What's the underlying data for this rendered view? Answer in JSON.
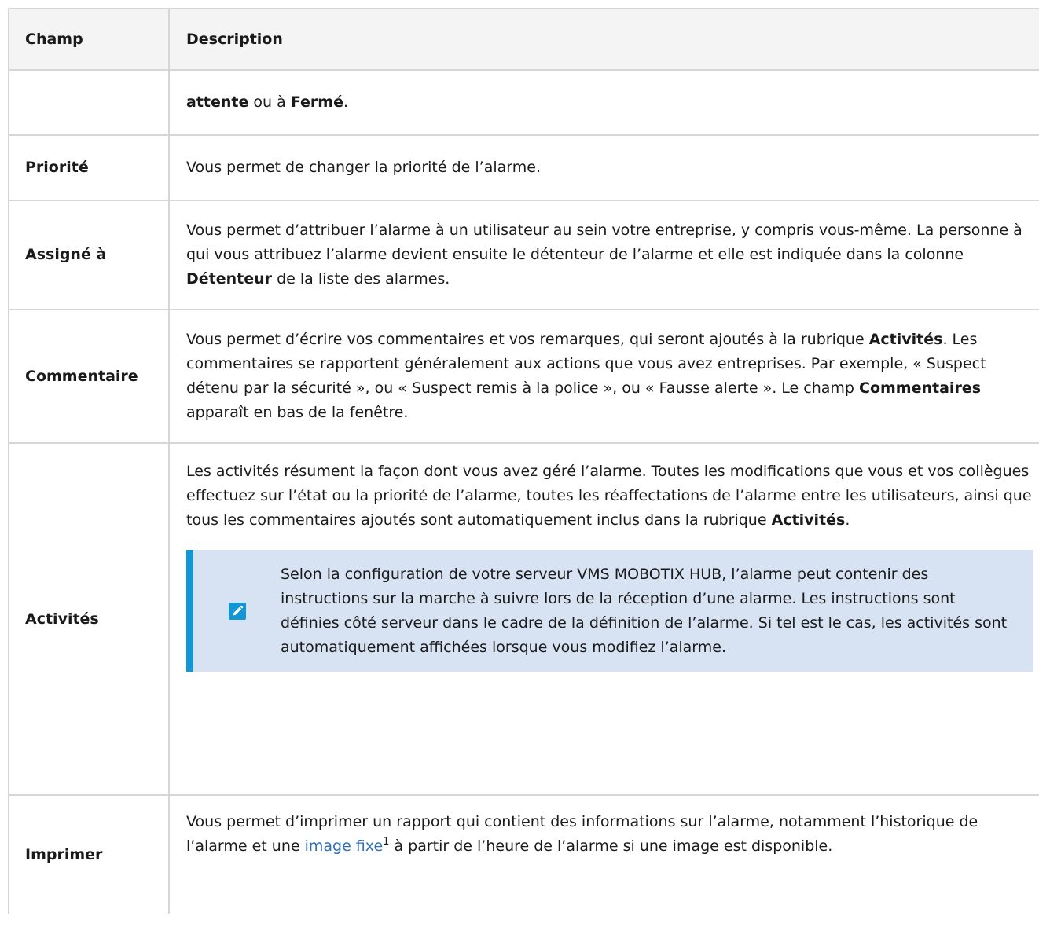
{
  "table": {
    "headers": {
      "field": "Champ",
      "description": "Description"
    },
    "rows": {
      "continuation": {
        "field": "",
        "desc_b1": "attente",
        "desc_t1": " ou à ",
        "desc_b2": "Fermé",
        "desc_t2": "."
      },
      "priorite": {
        "field": "Priorité",
        "desc": "Vous permet de changer la priorité de l’alarme."
      },
      "assigne": {
        "field": "Assigné à",
        "desc_t1": "Vous permet d’attribuer l’alarme à un utilisateur au sein votre entreprise, y compris vous-même. La personne à qui vous attribuez l’alarme devient ensuite le détenteur de l’alarme et elle est indiquée dans la colonne ",
        "desc_b1": "Détenteur",
        "desc_t2": " de la liste des alarmes."
      },
      "commentaire": {
        "field": "Commentaire",
        "desc_t1": "Vous permet d’écrire vos commentaires et vos remarques, qui seront ajoutés à la rubrique ",
        "desc_b1": "Activités",
        "desc_t2": ". Les commentaires se rapportent généralement aux actions que vous avez entreprises. Par exemple, « Suspect détenu par la sécurité », ou « Suspect remis à la police », ou « Fausse alerte ». Le champ ",
        "desc_b2": "Commentaires",
        "desc_t3": " apparaît en bas de la fenêtre."
      },
      "activites": {
        "field": "Activités",
        "desc_t1": "Les activités résument la façon dont vous avez géré l’alarme. Toutes les modifications que vous et vos collègues effectuez sur l’état ou la priorité de l’alarme, toutes les réaffectations de l’alarme entre les utilisateurs, ainsi que tous les commentaires ajoutés sont automatiquement inclus dans la rubrique ",
        "desc_b1": "Activités",
        "desc_t2": ".",
        "note": {
          "icon": "pencil-icon",
          "text": "Selon la configuration de votre serveur VMS MOBOTIX HUB, l’alarme peut contenir des instructions sur la marche à suivre lors de la réception d’une alarme. Les instructions sont définies côté serveur dans le cadre de la définition de l’alarme. Si tel est le cas, les activités sont automatiquement affichées lorsque vous modifiez l’alarme."
        }
      },
      "imprimer": {
        "field": "Imprimer",
        "desc_t1": "Vous permet d’imprimer un rapport qui contient des informations sur l’alarme, notamment l’historique de l’alarme et une ",
        "link": "image fixe",
        "footnote": "1",
        "desc_t2": " à partir de l’heure de l’alarme si une image est disponible."
      }
    }
  },
  "colors": {
    "header_bg": "#f4f4f4",
    "border": "#d6d6d6",
    "note_bg": "#d7e2f3",
    "note_accent": "#1296d6",
    "link": "#2f6fb5"
  }
}
